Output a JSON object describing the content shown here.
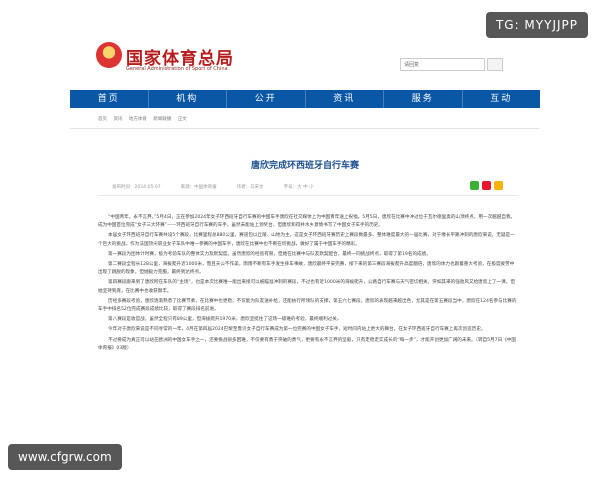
{
  "brand": {
    "title": "国家体育总局",
    "subtitle": "General Administration of Sport of China"
  },
  "search": {
    "value": "请回复"
  },
  "nav": [
    "首页",
    "机构",
    "公开",
    "资讯",
    "服务",
    "互动"
  ],
  "breadcrumb": [
    "首页",
    "资讯",
    "地方体育",
    "新闻联播",
    "正文"
  ],
  "article": {
    "title": "唐欣完成环西班牙自行车赛",
    "meta": [
      "发布时间：2024-05-07",
      "来源：中国体育报",
      "作者：马宋文",
      "字号：大 中 小"
    ],
    "paragraphs": [
      "“中国青年，永不言弃。”5月4日，正在参加2024年女子环西班牙自行车赛的中国车手唐欣在社交媒体上为中国青年送上祝福。5月5日，唐欣在比赛中冲过位于瓦尔德里奥的山顶终点，用一次越越自我，成为中国首位完成“女子三大环赛”——环西班牙自行车赛的车手，虽然未能站上领奖台，但唐欣和得并水乡意情书写了中国女子车手的历史。",
      "本届女子环西班牙自行车赛共设5个赛段，比赛里程总880公里，赛道包以丘陵、山地为主，这是女子环西班牙赛历史上赛段数最多、整体难度最大的一届比赛，对于缠长平路冲刺的唐欣来说，无疑是一个巨大的挑战。作为法国顶尖职业女子车队中唯一参赛的中国车手，唐欣在比赛中也不断在何挑战，做好了属于中国车手的精彩。",
      "第一赛段为团体计时赛，极为考验车队的整体实力及默契度。虽然唐欣的经验有限，但她在比赛中与队友默契配合，最终一同挑战终点，取得了第19名的成绩。",
      "第二赛段全程长128公里，海拔爬升近1000米，而且天公不作美，雨雨不断有车手发生摔车事故，唐欣最终平安完赛，接下来的第三赛段海拔爬升高度翻倍，唐欣的体力也跟着重大考验，在极度疲劳中出现了跳脱的现象，但她毅力克服，最终到达终点。",
      "第四赛段跟来到了唐欣所在车队的“主场”，也是本次比赛唯一能出来接可以被瞄准冲刺的赛段，不过也有近1000米的海拔爬升，公路自行车赛与天气密切相关，突如其来的强劲风又给唐欣上了一课，但她坚持到底，在比赛中也收获颇丰。",
      "历经多赛段考验，唐欣逐渐熟悉了比赛节奏，在比赛中也更稳，不仅能为队友送补给，还能执行所领队的支撑，第五六七赛段，唐欣的表现越来越出色，尤其是在第五赛段当中，唐欣在124名参与比赛的车手中排名52位完成赛段成绩比较，取得了赛段排名前进。",
      "第八赛段是收官战，虽然全程只有89公里，但海拔爬升1970米，唐欣坚挺住了这场一级难的考验，最终顺利过关。",
      "今年对于唐欣来说是不同寻常的一年，4月在第四届2024巴黎至鲁贝女子自行车赛成为第一位完赛的中国女子车手，短时间内站上更大的舞台，在女子环西班牙自行车赛上再次创造历史。",
      "不过要成为真正可以站在欧洲的中国女车手之一，还要挑战很多困难，不仅要有勇于突破的勇气，更要有永不言弃的坚毅，只有走稳走实成长的“每一步”，才能开创更加广阔的未来。（转自5月7日《中国体育报》03版）"
    ]
  },
  "watermarks": {
    "top_right": "TG: MYYJJPP",
    "bottom_left": "www.cfgrw.com"
  },
  "colors": {
    "nav_bg": "#0a57a5",
    "brand_red": "#b71c1c",
    "title_blue": "#1c4f8f"
  }
}
